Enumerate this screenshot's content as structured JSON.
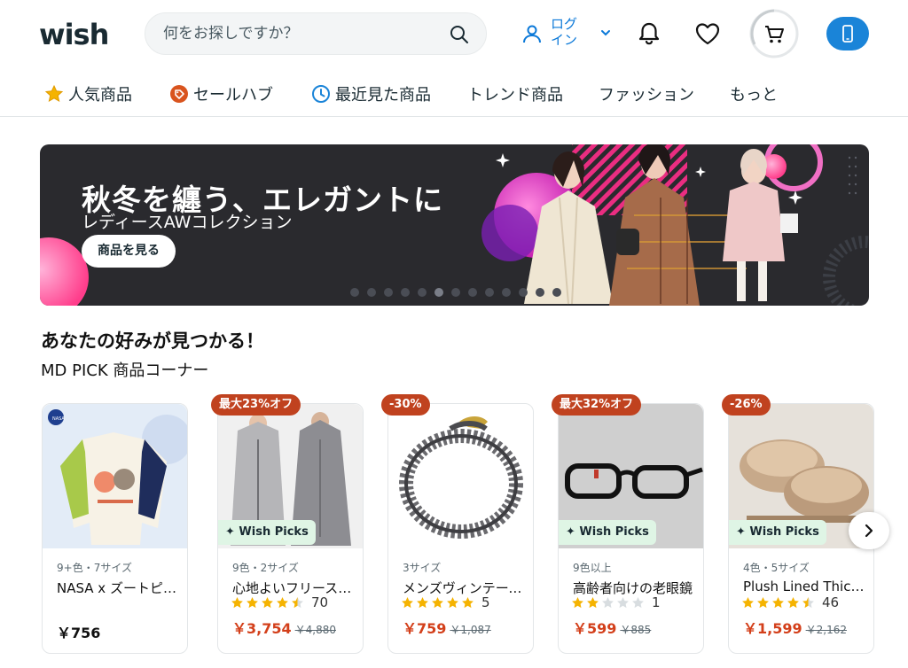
{
  "header": {
    "logo": "wish",
    "search_placeholder": "何をお探しですか？",
    "login_label_line1": "ログ",
    "login_label_line2": "イン"
  },
  "nav": {
    "items": [
      {
        "label": "人気商品",
        "icon": "star-icon"
      },
      {
        "label": "セールハブ",
        "icon": "tag-icon"
      },
      {
        "label": "最近見た商品",
        "icon": "clock-icon"
      },
      {
        "label": "トレンド商品"
      },
      {
        "label": "ファッション"
      },
      {
        "label": "もっと"
      }
    ]
  },
  "banner": {
    "title": "秋冬を纏う、エレガントに",
    "subtitle": "レディースAWコレクション",
    "button": "商品を見る",
    "active_slide_index": 5,
    "slide_count": 13
  },
  "section": {
    "title": "あなたの好みが見つかる！",
    "subtitle": "MD PICK 商品コーナー"
  },
  "products": [
    {
      "badge": "",
      "picks": "",
      "meta": "9+色・7サイズ",
      "name": "NASA x ズートピア スウェット",
      "rating": null,
      "rating_count": "",
      "price": "￥756",
      "orig": ""
    },
    {
      "badge": "最大23%オフ",
      "picks": "Wish Picks",
      "meta": "9色・2サイズ",
      "name": "心地よいフリースパーカー",
      "rating": 4.5,
      "rating_count": "70",
      "price": "￥3,754",
      "orig": "￥4,880"
    },
    {
      "badge": "-30%",
      "picks": "",
      "meta": "3サイズ",
      "name": "メンズヴィンテージブレスレット",
      "rating": 5,
      "rating_count": "5",
      "price": "￥759",
      "orig": "￥1,087"
    },
    {
      "badge": "最大32%オフ",
      "picks": "Wish Picks",
      "meta": "9色以上",
      "name": "高齢者向けの老眼鏡",
      "rating": 2,
      "rating_count": "1",
      "price": "￥599",
      "orig": "￥885"
    },
    {
      "badge": "-26%",
      "picks": "Wish Picks",
      "meta": "4色・5サイズ",
      "name": "Plush Lined Thick Slippers",
      "rating": 4.5,
      "rating_count": "46",
      "price": "￥1,599",
      "orig": "￥2,162"
    }
  ],
  "colors": {
    "brand_blue": "#1a84d8",
    "badge_red": "#c0421f",
    "price_red": "#d33f1a",
    "star_gold": "#f5b301",
    "picks_green": "#dff5e5"
  }
}
